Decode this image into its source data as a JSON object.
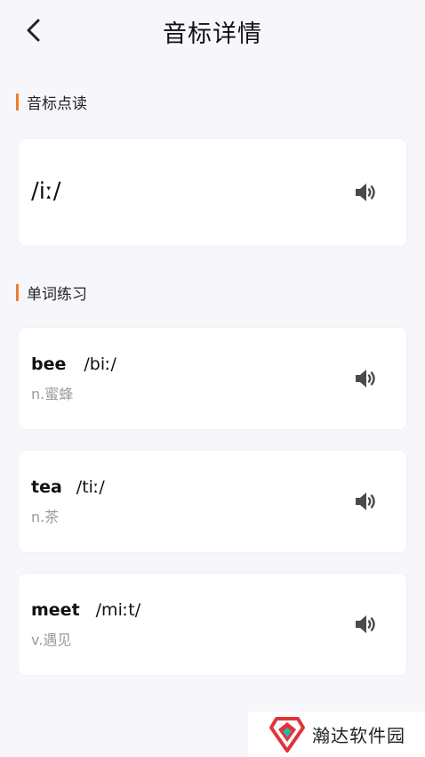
{
  "header": {
    "title": "音标详情"
  },
  "phonetic_section": {
    "label": "音标点读",
    "symbol": "/iː/"
  },
  "words_section": {
    "label": "单词练习",
    "items": [
      {
        "word": "bee",
        "ipa": "/biː/",
        "meaning": "n.蜜蜂"
      },
      {
        "word": "tea",
        "ipa": "/tiː/",
        "meaning": "n.茶"
      },
      {
        "word": "meet",
        "ipa": "/miːt/",
        "meaning": "v.遇见"
      }
    ]
  },
  "watermark": {
    "text": "瀚达软件园"
  },
  "colors": {
    "accent": "#ef7d2d",
    "background": "#f7f7fb",
    "card": "#ffffff",
    "secondary_text": "#9a9a9a",
    "watermark_red": "#e0343a",
    "watermark_teal": "#2bb3a6"
  },
  "icons": {
    "back": "chevron-left-icon",
    "play": "speaker-icon",
    "logo": "hd-logo"
  }
}
